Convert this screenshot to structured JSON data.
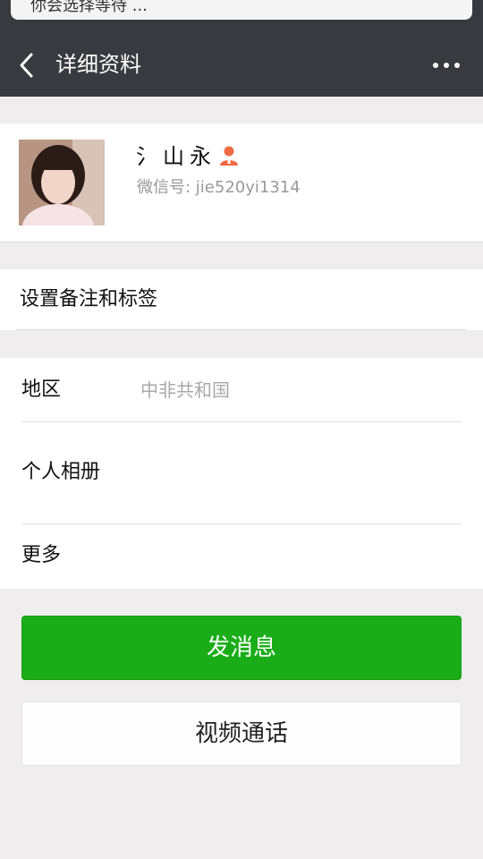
{
  "notification": {
    "text": "你会选择等待 ..."
  },
  "header": {
    "title": "详细资料",
    "back_icon": "back-chevron-icon",
    "more_icon": "more-dots-icon"
  },
  "profile": {
    "nickname": "氵山永",
    "wechat_id": "微信号: jie520yi1314",
    "person_icon_color": "#f06b43"
  },
  "remark": {
    "label": "设置备注和标签"
  },
  "info": {
    "region_label": "地区",
    "region_value": "中非共和国",
    "album_label": "个人相册",
    "more_label": "更多"
  },
  "actions": {
    "send_message": "发消息",
    "video_call": "视频通话"
  },
  "colors": {
    "header_bg": "#393a3f",
    "page_bg": "#efeded",
    "primary_green": "#1aad19"
  }
}
